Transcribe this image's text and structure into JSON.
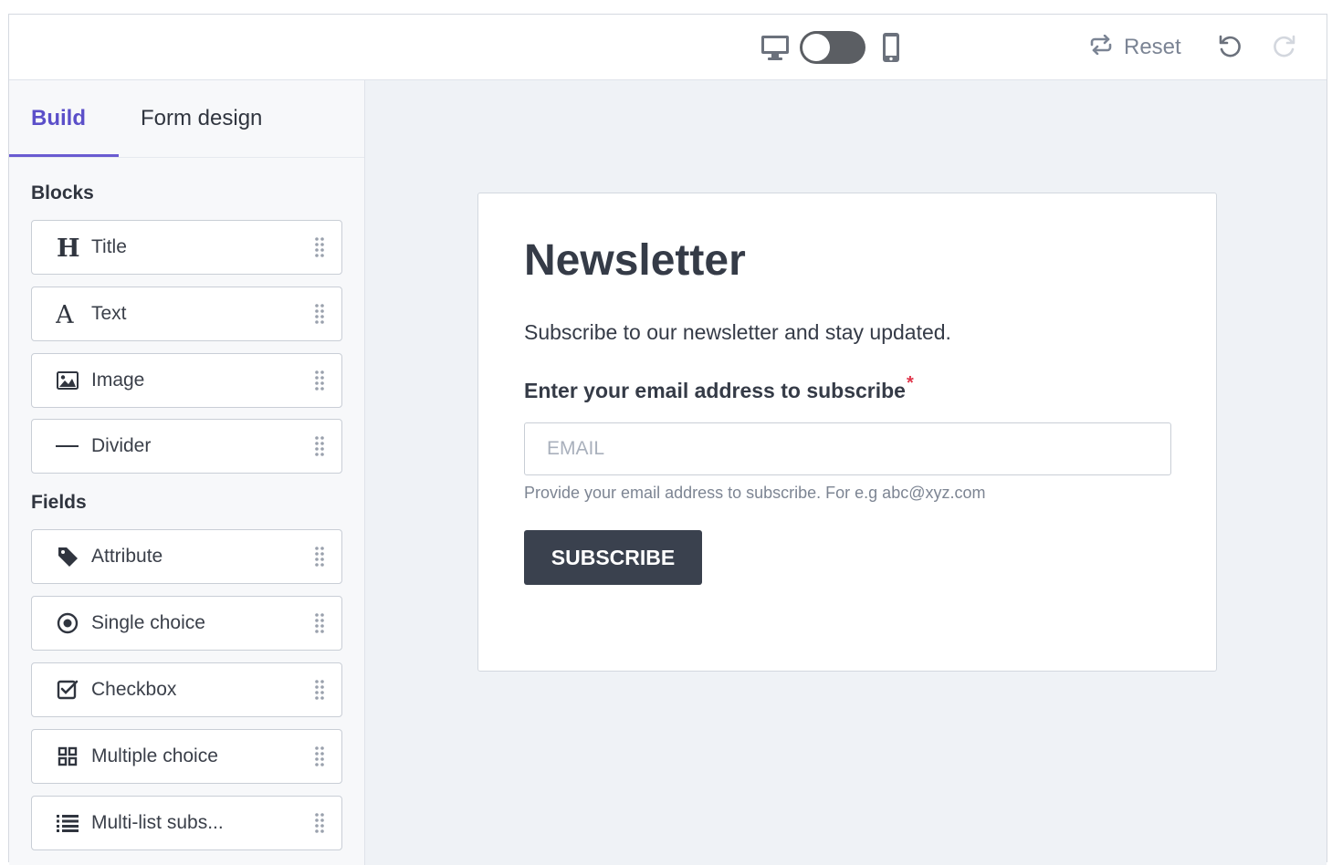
{
  "toolbar": {
    "desktop_icon": "desktop-icon",
    "mobile_icon": "mobile-icon",
    "view_toggle": "desktop",
    "reset_label": "Reset",
    "undo_icon": "undo-icon",
    "redo_icon": "redo-icon"
  },
  "sidebar": {
    "tabs": [
      {
        "label": "Build",
        "active": true
      },
      {
        "label": "Form design",
        "active": false
      }
    ],
    "blocks_title": "Blocks",
    "blocks": [
      {
        "label": "Title",
        "icon": "heading-icon"
      },
      {
        "label": "Text",
        "icon": "text-icon"
      },
      {
        "label": "Image",
        "icon": "image-icon"
      },
      {
        "label": "Divider",
        "icon": "divider-icon"
      }
    ],
    "fields_title": "Fields",
    "fields": [
      {
        "label": "Attribute",
        "icon": "tag-icon"
      },
      {
        "label": "Single choice",
        "icon": "radio-icon"
      },
      {
        "label": "Checkbox",
        "icon": "checkbox-icon"
      },
      {
        "label": "Multiple choice",
        "icon": "grid-icon"
      },
      {
        "label": "Multi-list subs...",
        "icon": "list-icon"
      }
    ]
  },
  "form": {
    "title": "Newsletter",
    "subtitle": "Subscribe to our newsletter and stay updated.",
    "email_label": "Enter your email address to subscribe",
    "required_mark": "*",
    "email_placeholder": "EMAIL",
    "email_help": "Provide your email address to subscribe. For e.g abc@xyz.com",
    "button_label": "SUBSCRIBE"
  },
  "colors": {
    "accent": "#5b4fc9",
    "button": "#3a414e",
    "canvas": "#eff2f6",
    "required": "#e0364b"
  }
}
